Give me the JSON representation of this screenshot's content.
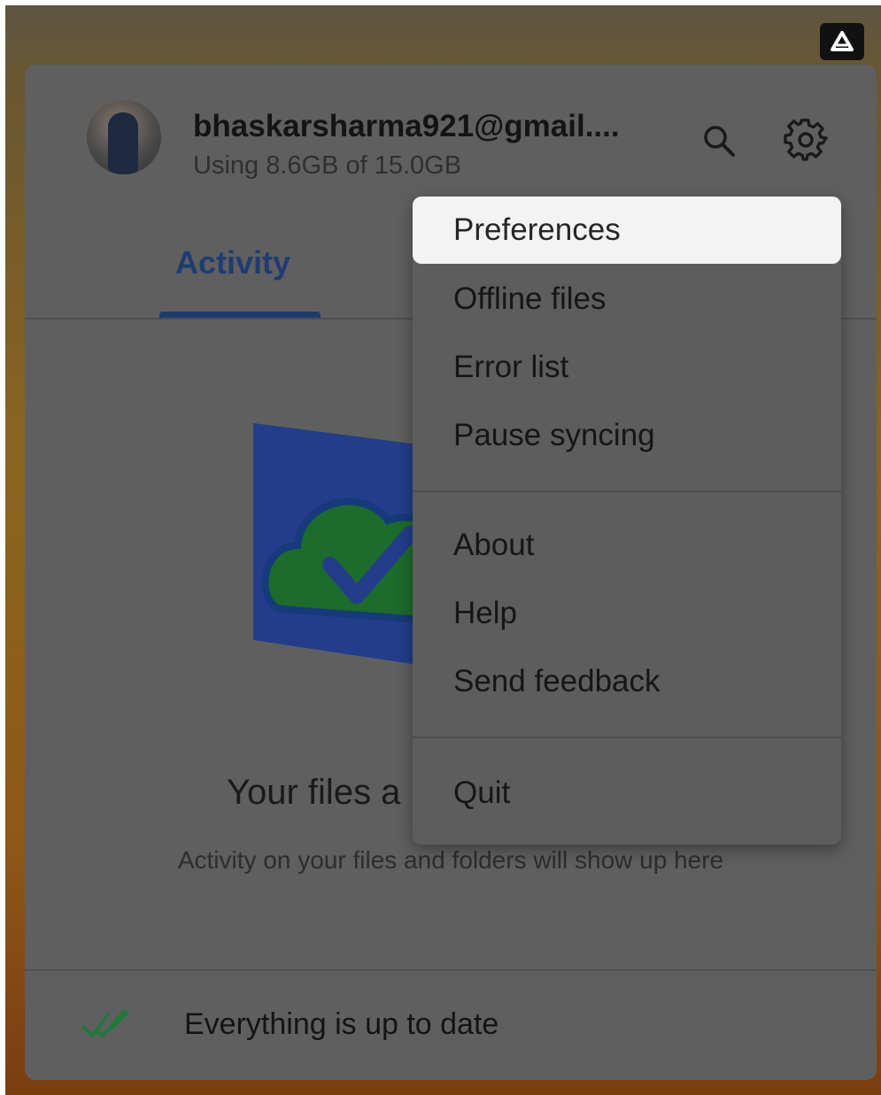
{
  "account": {
    "email": "bhaskarsharma921@gmail....",
    "usage": "Using 8.6GB of 15.0GB"
  },
  "tabs": [
    {
      "label": "Activity",
      "active": true
    }
  ],
  "empty_state": {
    "title": "Your files a",
    "subtitle": "Activity on your files and folders will show up here"
  },
  "status": {
    "text": "Everything is up to date"
  },
  "menu": {
    "items": [
      {
        "label": "Preferences",
        "highlighted": true
      },
      {
        "label": "Offline files"
      },
      {
        "label": "Error list"
      },
      {
        "label": "Pause syncing"
      },
      {
        "label": "About"
      },
      {
        "label": "Help"
      },
      {
        "label": "Send feedback"
      },
      {
        "label": "Quit"
      }
    ]
  },
  "icons": {
    "tray": "google-drive-icon",
    "search": "search-icon",
    "settings": "gear-icon",
    "status": "double-check-icon",
    "illustration": "cloud-check-folder-icon"
  },
  "colors": {
    "accent": "#1f3c72",
    "status_check": "#1e7a3a",
    "folder_blue": "#233d8a",
    "cloud_green": "#1d6b2d"
  }
}
